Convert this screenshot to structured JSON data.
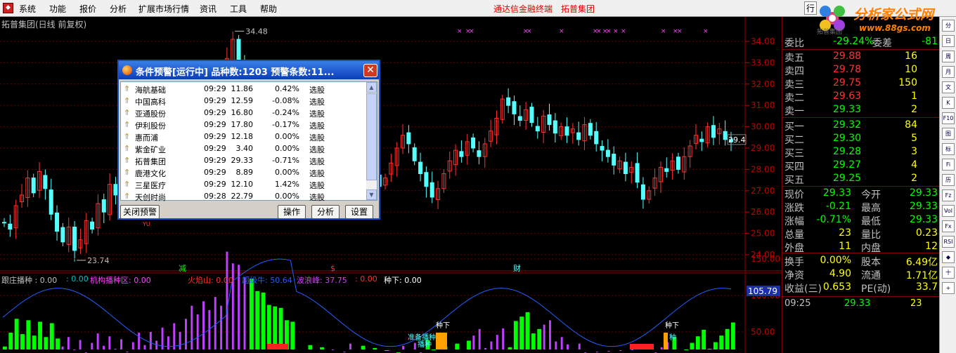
{
  "menu": {
    "icon": "app-icon",
    "items": [
      "系统",
      "功能",
      "报价",
      "分析",
      "扩展市场行情",
      "资讯",
      "工具",
      "帮助"
    ],
    "center_title": "通达信金融终端",
    "stock_title": "拓普集团",
    "trade_btn": "行"
  },
  "logo": {
    "brand": "分析家公式网",
    "url": "www.88gs.com",
    "caption": "拓普集团"
  },
  "chart_header": "拓普集团(日线 前复权)",
  "price_axis": {
    "labels": [
      "34.00",
      "33.00",
      "32.00",
      "31.00",
      "30.00",
      "29.00",
      "28.00",
      "27.00",
      "26.00",
      "25.00",
      "24.00"
    ]
  },
  "price_annotations": {
    "high": "34.48",
    "low": "23.74",
    "last": "29.4",
    "markers": [
      "减",
      "$",
      "财"
    ],
    "yu": "YU"
  },
  "indicator": {
    "labels": [
      {
        "text": "跟庄播种 : 0.00",
        "color": "#c0c0c0"
      },
      {
        "text": ": 0.00",
        "color": "#00c0c0"
      },
      {
        "text": "机构播种区: 0.00",
        "color": "#ff40ff"
      },
      {
        "text": "火焰山: 0.00",
        "color": "#ff3030"
      },
      {
        "text": "超级牛: 50.64",
        "color": "#2060ff"
      },
      {
        "text": "波浪峰: 37.75",
        "color": "#d040ff"
      },
      {
        "text": ": 0.00",
        "color": "#ff3030"
      },
      {
        "text": "种下: 0.00",
        "color": "#ffffff"
      }
    ],
    "axis": [
      "150.00",
      "100.00",
      "50.00"
    ],
    "current": "105.79",
    "annotations": [
      "种下",
      "种下",
      "准备播种",
      "播种",
      "种"
    ]
  },
  "quote": {
    "wb": {
      "label": "委比",
      "value": "-29.24%",
      "label2": "委差",
      "value2": "-81"
    },
    "asks": [
      {
        "label": "卖五",
        "price": "29.88",
        "vol": "16"
      },
      {
        "label": "卖四",
        "price": "29.78",
        "vol": "10"
      },
      {
        "label": "卖三",
        "price": "29.75",
        "vol": "150"
      },
      {
        "label": "卖二",
        "price": "29.63",
        "vol": "1"
      },
      {
        "label": "卖一",
        "price": "29.33",
        "vol": "2"
      }
    ],
    "bids": [
      {
        "label": "买一",
        "price": "29.32",
        "vol": "84"
      },
      {
        "label": "买二",
        "price": "29.30",
        "vol": "5"
      },
      {
        "label": "买三",
        "price": "29.28",
        "vol": "3"
      },
      {
        "label": "买四",
        "price": "29.27",
        "vol": "4"
      },
      {
        "label": "买五",
        "price": "29.25",
        "vol": "2"
      }
    ],
    "stats": [
      {
        "l1": "现价",
        "v1": "29.33",
        "l2": "今开",
        "v2": "29.33"
      },
      {
        "l1": "涨跌",
        "v1": "-0.21",
        "l2": "最高",
        "v2": "29.33"
      },
      {
        "l1": "涨幅",
        "v1": "-0.71%",
        "l2": "最低",
        "v2": "29.33"
      },
      {
        "l1": "总量",
        "v1": "23",
        "l2": "量比",
        "v2": "0.23"
      },
      {
        "l1": "外盘",
        "v1": "11",
        "l2": "内盘",
        "v2": "12"
      }
    ],
    "fund": [
      {
        "l1": "换手",
        "v1": "0.00%",
        "l2": "股本",
        "v2": "6.49亿"
      },
      {
        "l1": "净资",
        "v1": "4.90",
        "l2": "流通",
        "v2": "1.71亿"
      },
      {
        "l1": "收益(三)",
        "v1": "0.653",
        "l2": "PE(动)",
        "v2": "33.7"
      }
    ],
    "tick": {
      "time": "09:25",
      "price": "29.33",
      "vol": "23"
    }
  },
  "toolbar": [
    "分",
    "日",
    "周",
    "月",
    "文",
    "K",
    "F10",
    "图",
    "标",
    "Fi",
    "历",
    "Fz",
    "Vol",
    "Fx",
    "RSI",
    "◆",
    "十",
    "+"
  ],
  "dialog": {
    "title": "条件预警[运行中] 品种数:1203 预警条数:11...",
    "close": "✕",
    "rows": [
      {
        "name": "海航基础",
        "time": "09:29",
        "price": "11.86",
        "pct": "0.42%",
        "type": "选股"
      },
      {
        "name": "中国高科",
        "time": "09:29",
        "price": "12.59",
        "pct": "-0.08%",
        "type": "选股"
      },
      {
        "name": "亚通股份",
        "time": "09:29",
        "price": "16.80",
        "pct": "-0.24%",
        "type": "选股"
      },
      {
        "name": "伊利股份",
        "time": "09:29",
        "price": "17.80",
        "pct": "-0.17%",
        "type": "选股"
      },
      {
        "name": "惠而浦",
        "time": "09:29",
        "price": "12.18",
        "pct": "0.00%",
        "type": "选股"
      },
      {
        "name": "紫金矿业",
        "time": "09:29",
        "price": "3.40",
        "pct": "0.00%",
        "type": "选股"
      },
      {
        "name": "拓普集团",
        "time": "09:29",
        "price": "29.33",
        "pct": "-0.71%",
        "type": "选股"
      },
      {
        "name": "鹿港文化",
        "time": "09:29",
        "price": "8.89",
        "pct": "0.00%",
        "type": "选股"
      },
      {
        "name": "三星医疗",
        "time": "09:29",
        "price": "12.10",
        "pct": "1.42%",
        "type": "选股"
      },
      {
        "name": "天创时尚",
        "time": "09:28",
        "price": "22.79",
        "pct": "0.00%",
        "type": "选股"
      }
    ],
    "buttons": {
      "close_alert": "关闭预警",
      "operate": "操作",
      "analyze": "分析",
      "settings": "设置"
    }
  },
  "colors": {
    "up": "#ff3232",
    "down": "#54ffff",
    "grid": "#8b0000",
    "green": "#00ff00",
    "yellow": "#ffff00"
  }
}
